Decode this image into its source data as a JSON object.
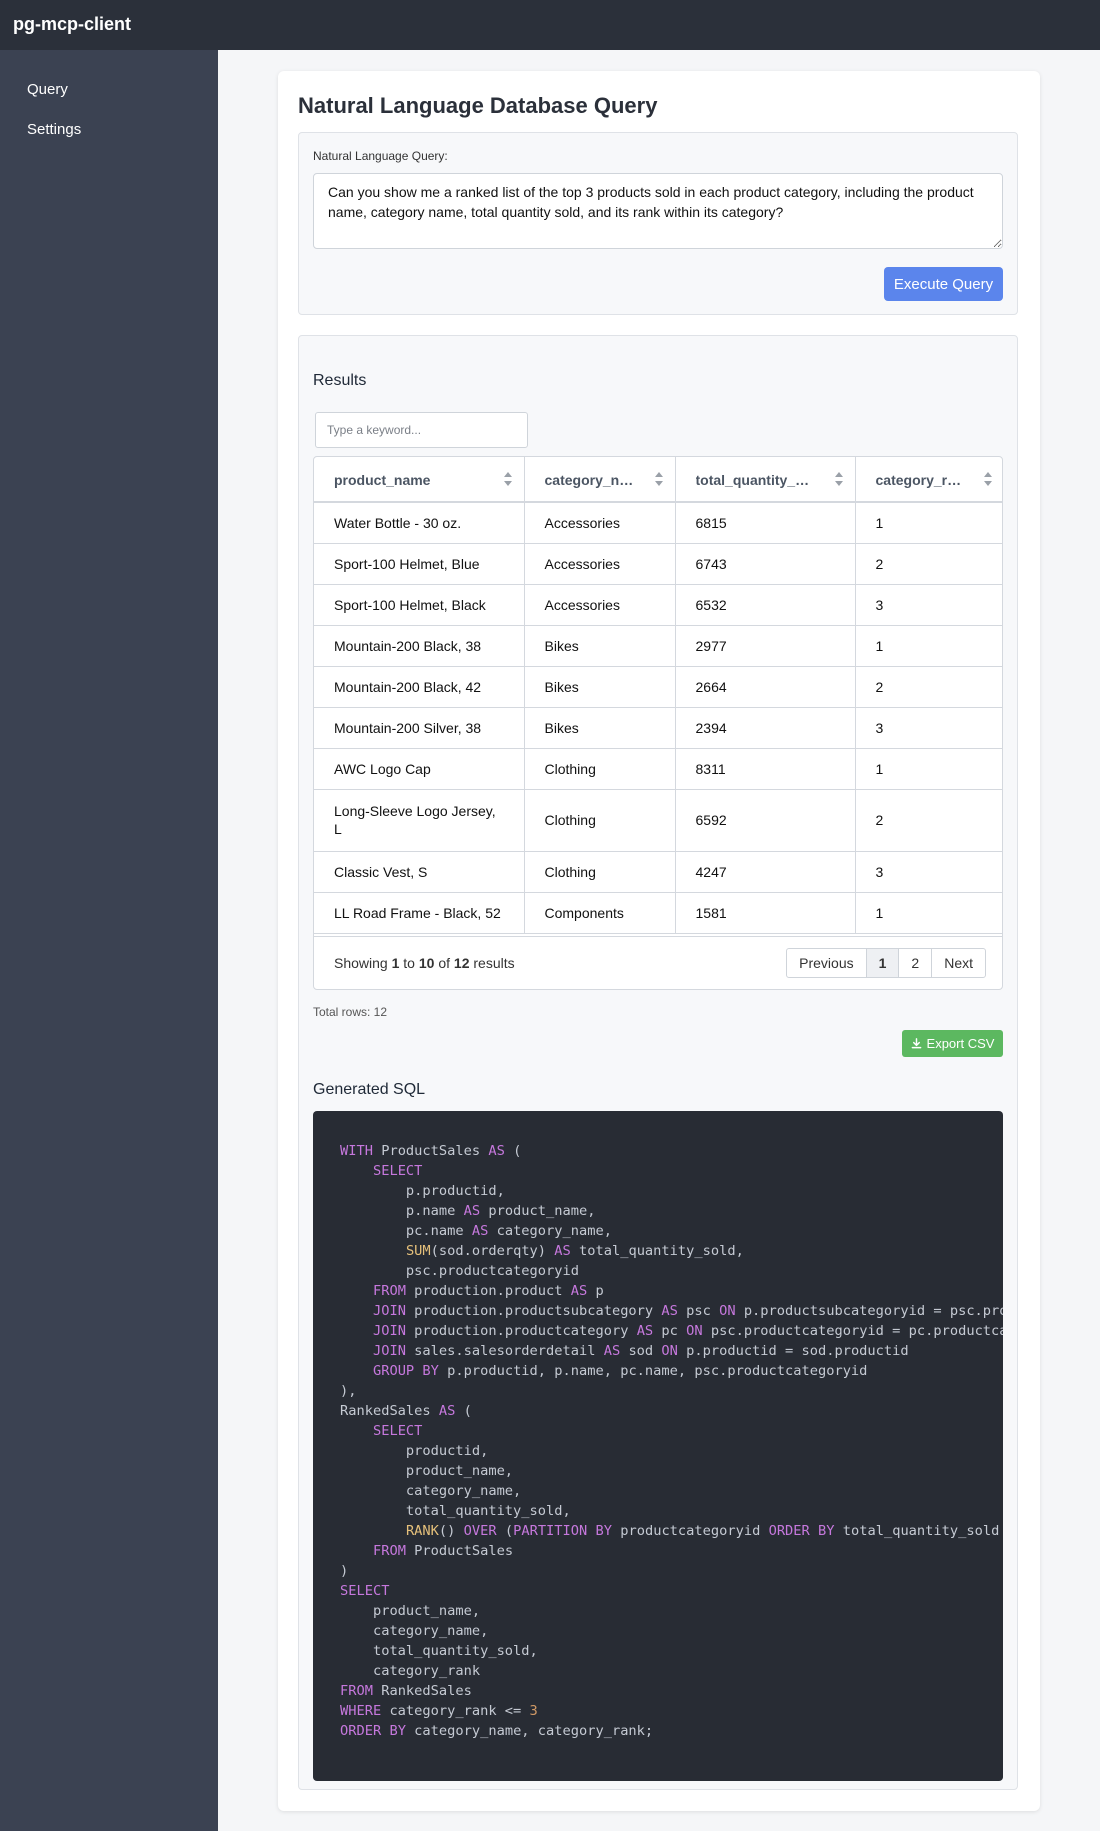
{
  "app": {
    "title": "pg-mcp-client"
  },
  "sidebar": {
    "items": [
      {
        "label": "Query"
      },
      {
        "label": "Settings"
      }
    ]
  },
  "page": {
    "title": "Natural Language Database Query"
  },
  "query": {
    "label": "Natural Language Query:",
    "value": "Can you show me a ranked list of the top 3 products sold in each product category, including the product name, category name, total quantity sold, and its rank within its category?",
    "execute_label": "Execute Query"
  },
  "results": {
    "title": "Results",
    "search_placeholder": "Type a keyword...",
    "columns": [
      {
        "label": "product_name"
      },
      {
        "label": "category_name"
      },
      {
        "label": "total_quantity_sold"
      },
      {
        "label": "category_rank"
      }
    ],
    "rows": [
      [
        "Water Bottle - 30 oz.",
        "Accessories",
        "6815",
        "1"
      ],
      [
        "Sport-100 Helmet, Blue",
        "Accessories",
        "6743",
        "2"
      ],
      [
        "Sport-100 Helmet, Black",
        "Accessories",
        "6532",
        "3"
      ],
      [
        "Mountain-200 Black, 38",
        "Bikes",
        "2977",
        "1"
      ],
      [
        "Mountain-200 Black, 42",
        "Bikes",
        "2664",
        "2"
      ],
      [
        "Mountain-200 Silver, 38",
        "Bikes",
        "2394",
        "3"
      ],
      [
        "AWC Logo Cap",
        "Clothing",
        "8311",
        "1"
      ],
      [
        "Long-Sleeve Logo Jersey, L",
        "Clothing",
        "6592",
        "2"
      ],
      [
        "Classic Vest, S",
        "Clothing",
        "4247",
        "3"
      ],
      [
        "LL Road Frame - Black, 52",
        "Components",
        "1581",
        "1"
      ]
    ],
    "pagination": {
      "showing_prefix": "Showing",
      "from": "1",
      "to_word": "to",
      "to": "10",
      "of_word": "of",
      "total": "12",
      "suffix": "results",
      "previous_label": "Previous",
      "pages": [
        "1",
        "2"
      ],
      "current_page": "1",
      "next_label": "Next"
    },
    "total_rows_text": "Total rows: 12",
    "export_label": "Export CSV",
    "export_color": "#5cb860"
  },
  "sql": {
    "title": "Generated SQL",
    "code": "WITH ProductSales AS (\n    SELECT\n        p.productid,\n        p.name AS product_name,\n        pc.name AS category_name,\n        SUM(sod.orderqty) AS total_quantity_sold,\n        psc.productcategoryid\n    FROM production.product AS p\n    JOIN production.productsubcategory AS psc ON p.productsubcategoryid = psc.productsubcategoryid\n    JOIN production.productcategory AS pc ON psc.productcategoryid = pc.productcategoryid\n    JOIN sales.salesorderdetail AS sod ON p.productid = sod.productid\n    GROUP BY p.productid, p.name, pc.name, psc.productcategoryid\n),\nRankedSales AS (\n    SELECT\n        productid,\n        product_name,\n        category_name,\n        total_quantity_sold,\n        RANK() OVER (PARTITION BY productcategoryid ORDER BY total_quantity_sold DESC) AS category_rank\n    FROM ProductSales\n)\nSELECT\n    product_name,\n    category_name,\n    total_quantity_sold,\n    category_rank\nFROM RankedSales\nWHERE category_rank <= 3\nORDER BY category_name, category_rank;"
  },
  "colors": {
    "accent": "#5b85ec",
    "topbar": "#2b303a",
    "sidebar": "#3b4252",
    "code_bg": "#282c34",
    "keyword": "#c678dd",
    "function": "#e5c07b",
    "number": "#d19a66"
  }
}
